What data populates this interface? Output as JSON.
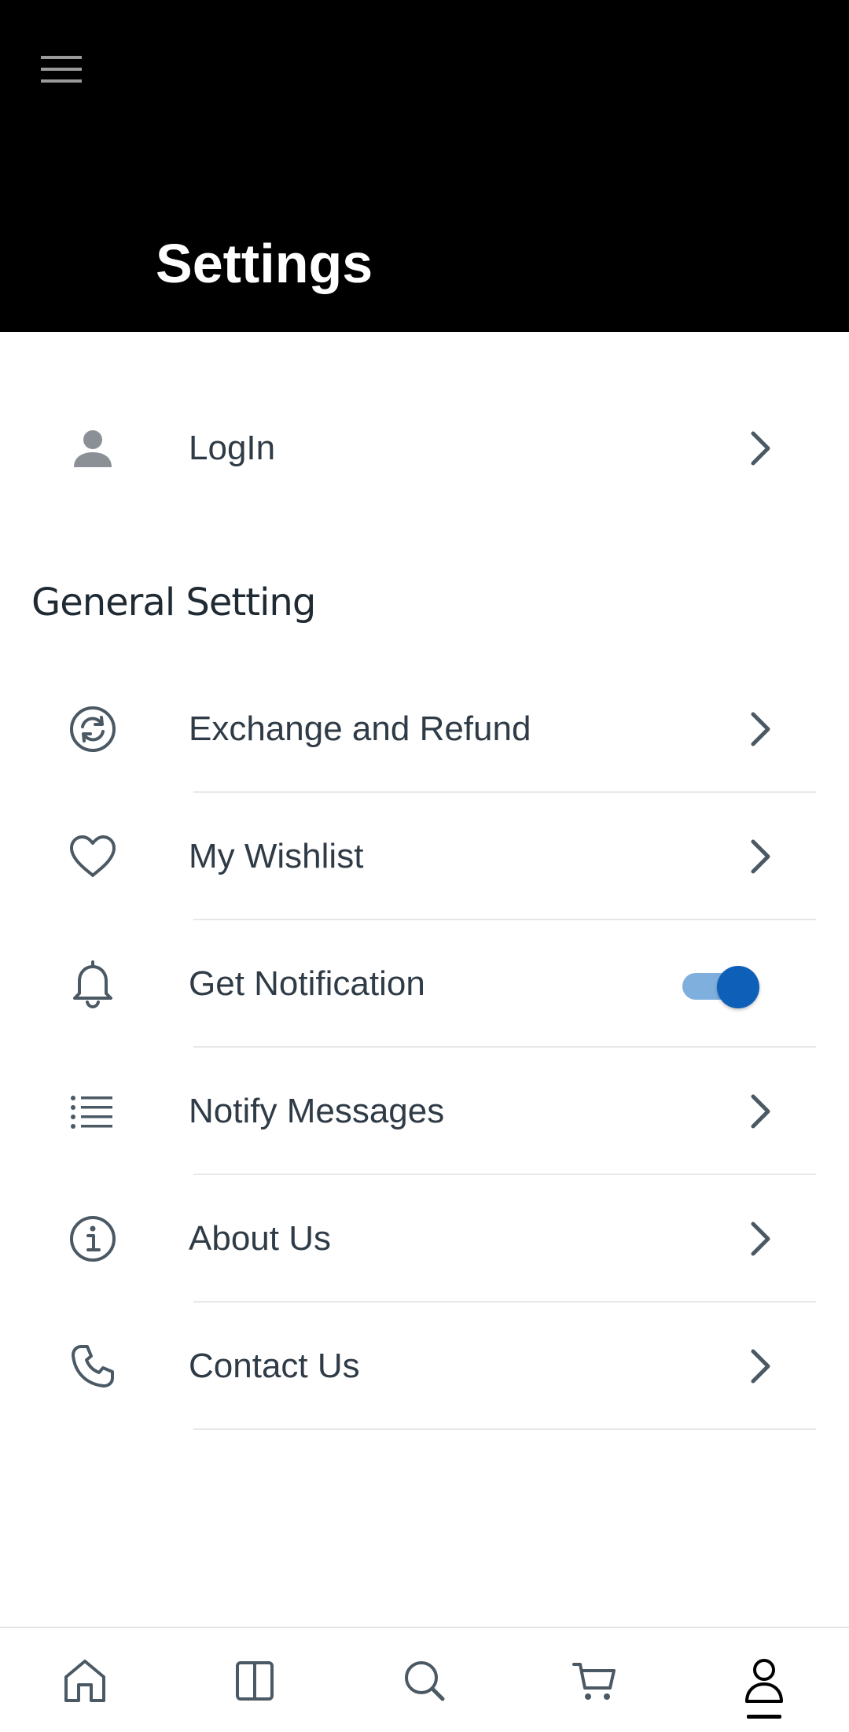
{
  "header": {
    "title": "Settings",
    "menu_icon": "hamburger-menu-icon",
    "background": "#000000"
  },
  "login": {
    "label": "LogIn",
    "icon": "person-icon"
  },
  "general": {
    "section_title": "General Setting",
    "items": [
      {
        "label": "Exchange and Refund",
        "icon": "refresh-circle-icon",
        "control": "chevron"
      },
      {
        "label": "My Wishlist",
        "icon": "heart-icon",
        "control": "chevron"
      },
      {
        "label": "Get Notification",
        "icon": "bell-icon",
        "control": "toggle",
        "toggle_on": true
      },
      {
        "label": "Notify Messages",
        "icon": "list-icon",
        "control": "chevron"
      },
      {
        "label": "About Us",
        "icon": "info-circle-icon",
        "control": "chevron"
      },
      {
        "label": "Contact Us",
        "icon": "phone-icon",
        "control": "chevron"
      }
    ]
  },
  "bottom_nav": {
    "items": [
      {
        "icon": "home-icon",
        "active": false
      },
      {
        "icon": "categories-icon",
        "active": false
      },
      {
        "icon": "search-icon",
        "active": false
      },
      {
        "icon": "cart-icon",
        "active": false
      },
      {
        "icon": "profile-icon",
        "active": true
      }
    ]
  },
  "colors": {
    "text": "#2f3b46",
    "icon": "#4a5964",
    "toggle_track": "#7fb0dd",
    "toggle_knob": "#0d5fb8",
    "divider": "#e6e8ea"
  }
}
